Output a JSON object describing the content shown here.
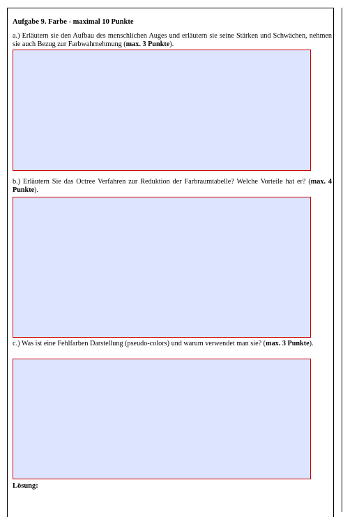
{
  "exercise": {
    "title": "Aufgabe 9. Farbe - maximal 10 Punkte"
  },
  "questions": [
    {
      "text": "a.) Erläutern sie den Aufbau des menschlichen Auges und erläutern sie seine Stärken und Schwächen, nehmen sie auch Bezug zur Farbwahrnehmung (",
      "points": "max. 3 Punkte",
      "suffix": ").",
      "answer": ""
    },
    {
      "text": "b.) Erläutern Sie das Octree Verfahren zur Reduktion der Farbraumtabelle? Welche Vorteile hat er? (",
      "points": "max. 4 Punkte",
      "suffix": ").",
      "answer": ""
    },
    {
      "text": "c.) Was ist eine Fehlfarben Darstellung (pseudo-colors) und warum verwendet man sie? (",
      "points": "max. 3 Punkte",
      "suffix": ").",
      "answer": ""
    }
  ],
  "solution": {
    "label": "Lösung:"
  },
  "colors": {
    "field_fill": "#dde4ff",
    "field_border": "#cc0000"
  }
}
